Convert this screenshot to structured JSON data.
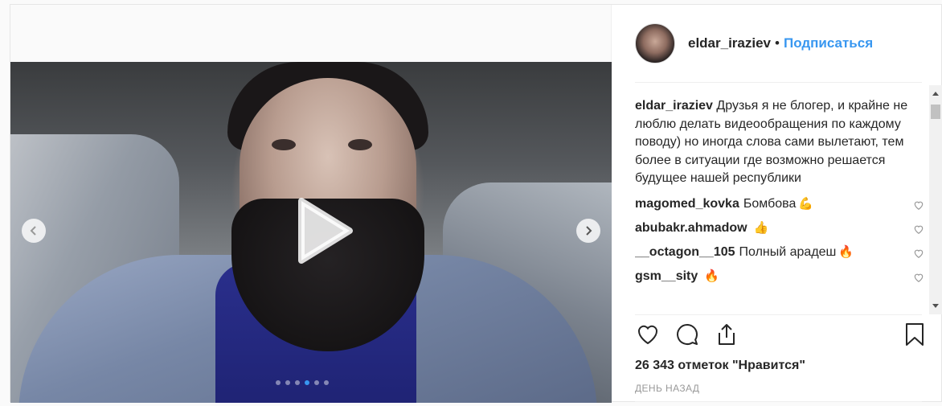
{
  "post": {
    "author": {
      "username": "eldar_iraziev",
      "separator": "•",
      "follow_label": "Подписаться"
    },
    "caption": {
      "username": "eldar_iraziev",
      "text": "Друзья я не блогер, и крайне не люблю делать видеообращения по каждому поводу) но иногда слова сами вылетают, тем более в ситуации где возможно решается будущее нашей республики"
    },
    "comments": [
      {
        "username": "magomed_kovka",
        "text": "Бомбова",
        "emoji": "💪"
      },
      {
        "username": "abubakr.ahmadow",
        "text": "",
        "emoji": "👍"
      },
      {
        "username": "__octagon__105",
        "text": "Полный арадеш",
        "emoji": "🔥"
      },
      {
        "username": "gsm__sity",
        "text": "",
        "emoji": "🔥"
      }
    ],
    "likes_text": "26 343 отметок \"Нравится\"",
    "timestamp": "ДЕНЬ НАЗАД",
    "carousel": {
      "total": 6,
      "active_index": 3
    }
  },
  "colors": {
    "accent": "#3897f0",
    "text": "#262626",
    "muted": "#999999"
  },
  "icons": {
    "play": "play-icon",
    "prev": "chevron-left-icon",
    "next": "chevron-right-icon",
    "like": "heart-icon",
    "comment": "comment-bubble-icon",
    "share": "share-icon",
    "save": "bookmark-icon"
  }
}
